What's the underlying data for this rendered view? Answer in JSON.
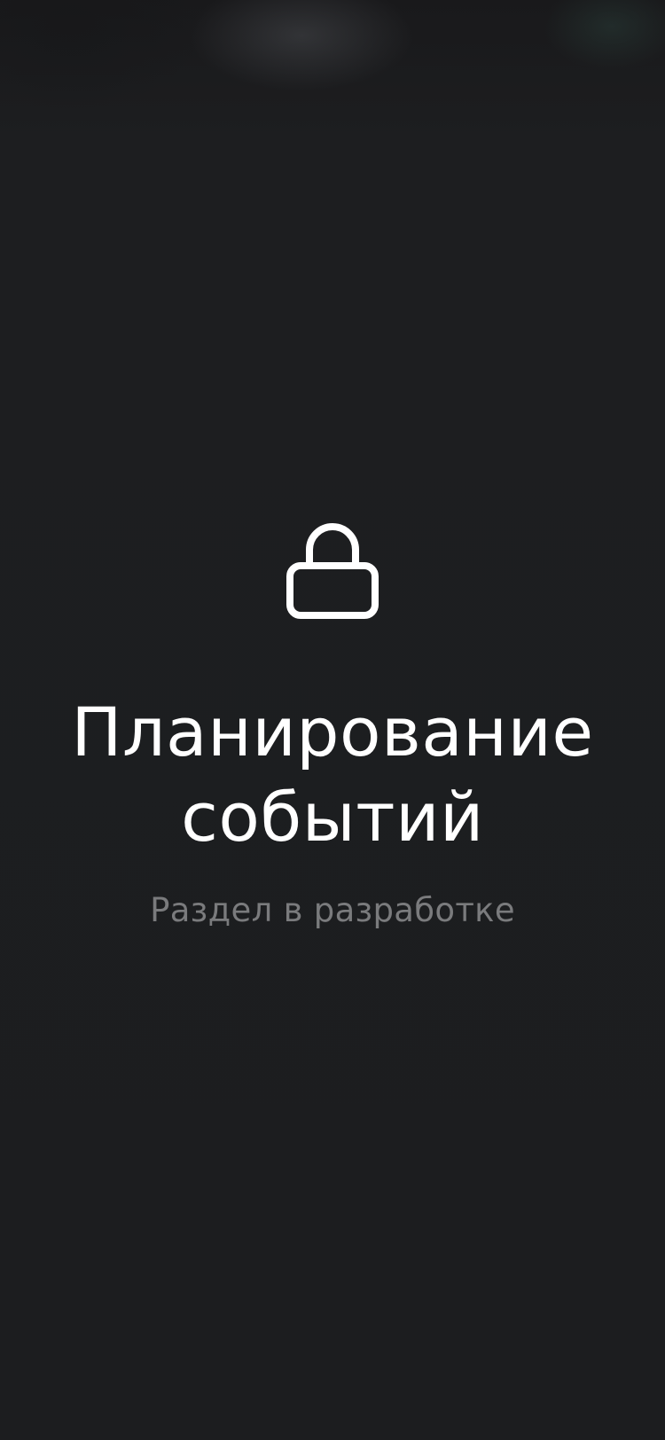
{
  "screen": {
    "icon": "lock-icon",
    "title": "Планирование событий",
    "subtitle": "Раздел в разработке"
  },
  "colors": {
    "background": "#1c1d1f",
    "title": "#ffffff",
    "subtitle": "#7a7b7d"
  }
}
